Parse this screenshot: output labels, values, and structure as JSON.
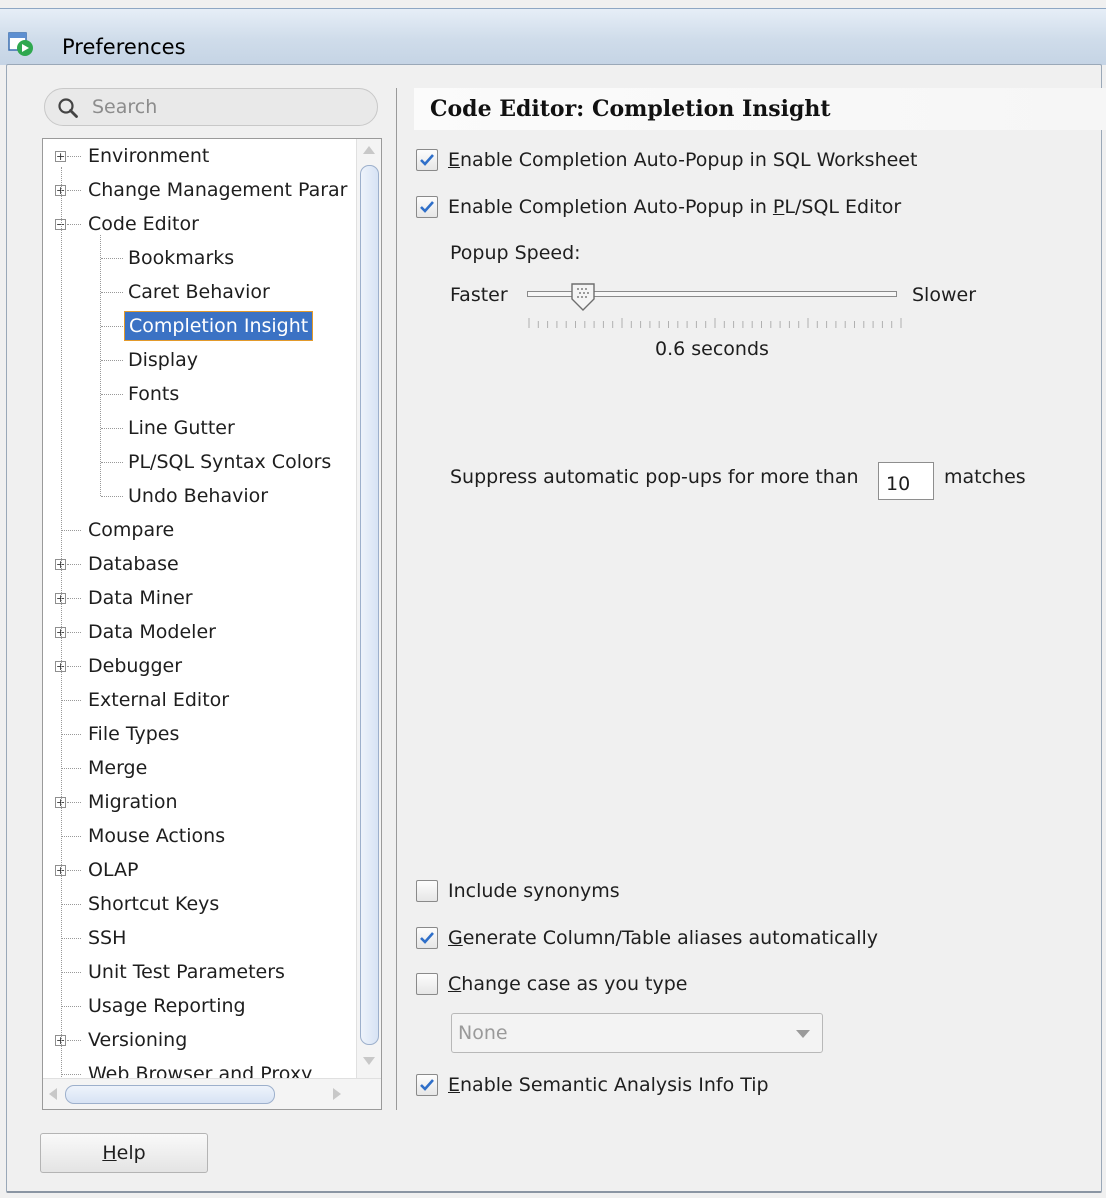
{
  "window": {
    "title": "Preferences"
  },
  "search": {
    "placeholder": "Search"
  },
  "tree": {
    "items": [
      {
        "label": "Environment",
        "expander": "+"
      },
      {
        "label": "Change Management Parar",
        "expander": "+"
      },
      {
        "label": "Code Editor",
        "expander": "-"
      },
      {
        "label": "Bookmarks"
      },
      {
        "label": "Caret Behavior"
      },
      {
        "label": "Completion Insight",
        "selected": true
      },
      {
        "label": "Display"
      },
      {
        "label": "Fonts"
      },
      {
        "label": "Line Gutter"
      },
      {
        "label": "PL/SQL Syntax Colors"
      },
      {
        "label": "Undo Behavior"
      },
      {
        "label": "Compare"
      },
      {
        "label": "Database",
        "expander": "+"
      },
      {
        "label": "Data Miner",
        "expander": "+"
      },
      {
        "label": "Data Modeler",
        "expander": "+"
      },
      {
        "label": "Debugger",
        "expander": "+"
      },
      {
        "label": "External Editor"
      },
      {
        "label": "File Types"
      },
      {
        "label": "Merge"
      },
      {
        "label": "Migration",
        "expander": "+"
      },
      {
        "label": "Mouse Actions"
      },
      {
        "label": "OLAP",
        "expander": "+"
      },
      {
        "label": "Shortcut Keys"
      },
      {
        "label": "SSH"
      },
      {
        "label": "Unit Test Parameters"
      },
      {
        "label": "Usage Reporting"
      },
      {
        "label": "Versioning",
        "expander": "+"
      },
      {
        "label": "Web Browser and Proxy"
      }
    ]
  },
  "main": {
    "title": "Code Editor: Completion Insight",
    "checkboxes": {
      "auto_popup_sql": {
        "mnemonic": "E",
        "rest": "nable Completion Auto-Popup in SQL Worksheet",
        "checked": true
      },
      "auto_popup_plsql": {
        "before": "Enable Completion Auto-Popup in ",
        "mnemonic": "P",
        "after": "L/SQL Editor",
        "checked": true
      },
      "include_synonyms": {
        "label": "Include synonyms",
        "checked": false
      },
      "generate_aliases": {
        "mnemonic": "G",
        "rest": "enerate Column/Table aliases automatically",
        "checked": true
      },
      "change_case": {
        "mnemonic": "C",
        "rest": "hange case as you type",
        "checked": false
      },
      "semantic_tip": {
        "mnemonic": "E",
        "rest": "nable Semantic Analysis Info Tip",
        "checked": true
      }
    },
    "popup_speed": {
      "label": "Popup Speed:",
      "min_label": "Faster",
      "max_label": "Slower",
      "value_text": "0.6 seconds",
      "level": 0.15
    },
    "suppress": {
      "before": "Suppress automatic pop-ups for more than",
      "value": "10",
      "after": "matches"
    },
    "case_select": {
      "value": "None"
    }
  },
  "footer": {
    "help_mnemonic": "H",
    "help_rest": "elp"
  },
  "colors": {
    "selection": "#3b72c4",
    "selection_border": "#e39a2b",
    "check": "#2f6fc9"
  }
}
